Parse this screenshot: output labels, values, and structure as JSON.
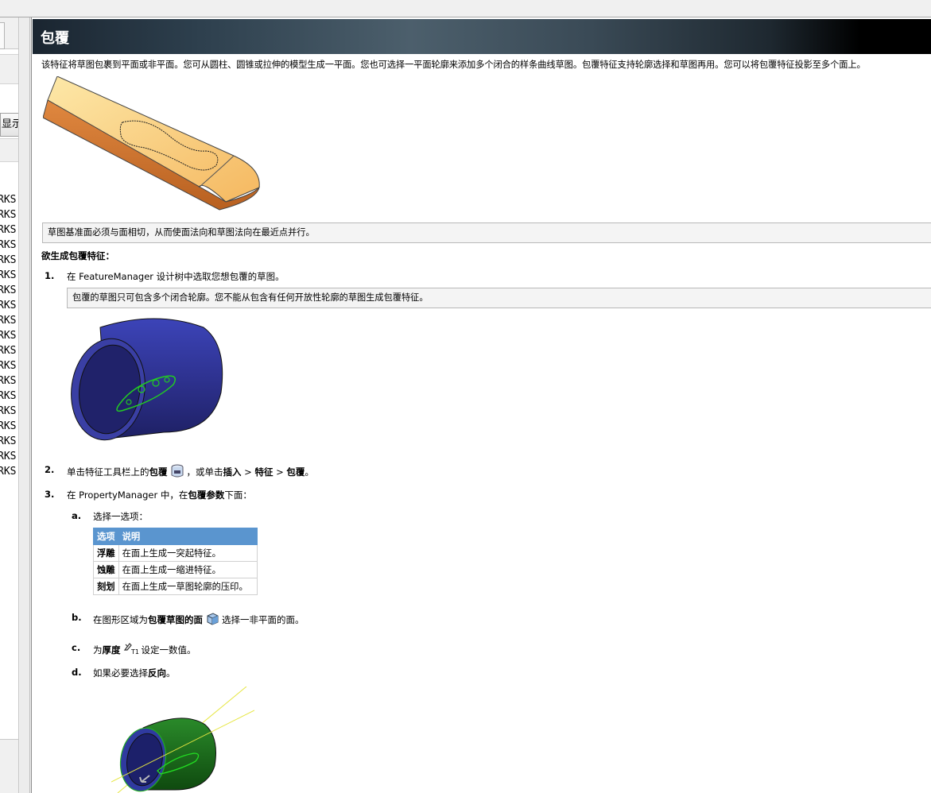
{
  "left_panel": {
    "button_label": "显示",
    "items": [
      "RKS",
      "RKS",
      "RKS",
      "RKS",
      "RKS",
      "RKS",
      "RKS",
      "RKS",
      "RKS",
      "RKS",
      "RKS",
      "RKS",
      "RKS",
      "RKS",
      "RKS",
      "RKS",
      "RKS",
      "RKS",
      "RKS"
    ]
  },
  "banner": {
    "title": "包覆"
  },
  "intro": "该特征将草图包裹到平面或非平面。您可从圆柱、圆锥或拉伸的模型生成一平面。您也可选择一平面轮廓来添加多个闭合的样条曲线草图。包覆特征支持轮廓选择和草图再用。您可以将包覆特征投影至多个面上。",
  "note1": "草图基准面必须与面相切，从而使面法向和草图法向在最近点并行。",
  "heading": "欲生成包覆特征：",
  "step1": {
    "num": "1.",
    "pre": "在 FeatureManager 设计树中选取您想包覆的草图。"
  },
  "note2": "包覆的草图只可包含多个闭合轮廓。您不能从包含有任何开放性轮廓的草图生成包覆特征。",
  "step2": {
    "num": "2.",
    "p1": "单击特征工具栏上的",
    "b1": "包覆",
    "p2": "，或单击",
    "b2": "插入",
    "p3": " > ",
    "b3": "特征",
    "p4": " > ",
    "b4": "包覆",
    "p5": "。"
  },
  "step3": {
    "num": "3.",
    "p1": "在 PropertyManager 中，在",
    "b1": "包覆参数",
    "p2": "下面："
  },
  "sub_a": {
    "letter": "a.",
    "text": "选择一选项："
  },
  "table": {
    "headers": [
      "选项",
      "说明"
    ],
    "rows": [
      [
        "浮雕",
        "在面上生成一突起特征。"
      ],
      [
        "蚀雕",
        "在面上生成一缩进特征。"
      ],
      [
        "刻划",
        "在面上生成一草图轮廓的压印。"
      ]
    ]
  },
  "sub_b": {
    "letter": "b.",
    "p1": "在图形区域为",
    "b1": "包覆草图的面",
    "p2": "选择一非平面的面。"
  },
  "sub_c": {
    "letter": "c.",
    "p1": "为",
    "b1": "厚度",
    "icon_text": "T1",
    "p2": "设定一数值。"
  },
  "sub_d": {
    "letter": "d.",
    "p1": "如果必要选择",
    "b1": "反向",
    "p2": "。"
  },
  "colors": {
    "banner_dark": "#1a2530",
    "table_header": "#5a95cf",
    "cylinder_blue": "#3a3f9e",
    "cylinder_green": "#1f6b1f",
    "block_orange": "#f0b060"
  },
  "icons": [
    "wrap-feature-icon",
    "face-select-icon",
    "thickness-icon"
  ]
}
